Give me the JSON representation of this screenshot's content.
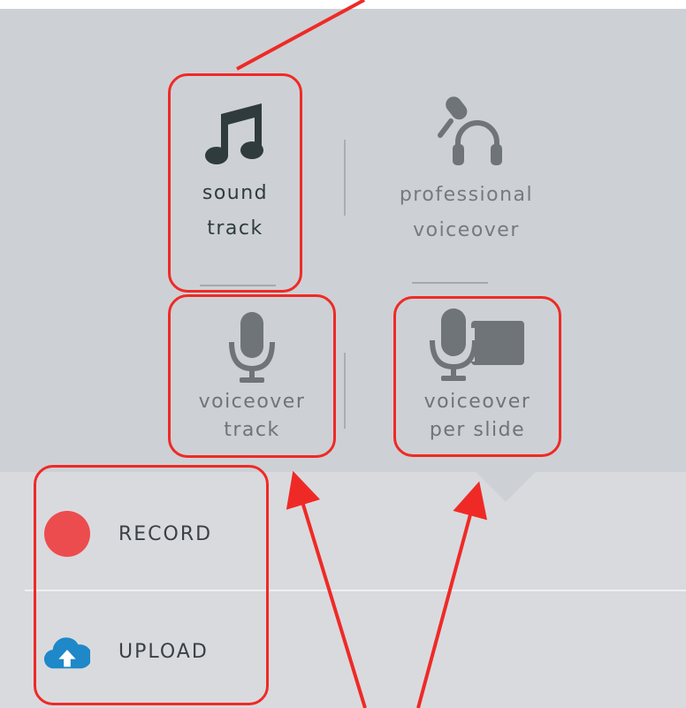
{
  "audio_options": {
    "sound_track": {
      "line1": "sound",
      "line2": "track",
      "icon": "music-note-icon",
      "selected": true
    },
    "professional_voiceover": {
      "line1": "professional",
      "line2": "voiceover",
      "icon": "microphone-headphones-icon"
    },
    "voiceover_track": {
      "line1": "voiceover",
      "line2": "track",
      "icon": "microphone-icon"
    },
    "voiceover_per_slide": {
      "line1": "voiceover",
      "line2": "per slide",
      "icon": "microphone-slides-icon"
    }
  },
  "actions": {
    "record": {
      "label": "RECORD",
      "icon": "record-dot-icon"
    },
    "upload": {
      "label": "UPLOAD",
      "icon": "cloud-upload-icon"
    }
  },
  "colors": {
    "panel_bg": "#cdd1d5",
    "bottom_bg": "#d9dade",
    "selected_text": "#2f3b3d",
    "muted_text": "#757a7f",
    "record_red": "#ec4c4e",
    "upload_blue": "#1e88c8",
    "annotation_red": "#ef2a26"
  }
}
